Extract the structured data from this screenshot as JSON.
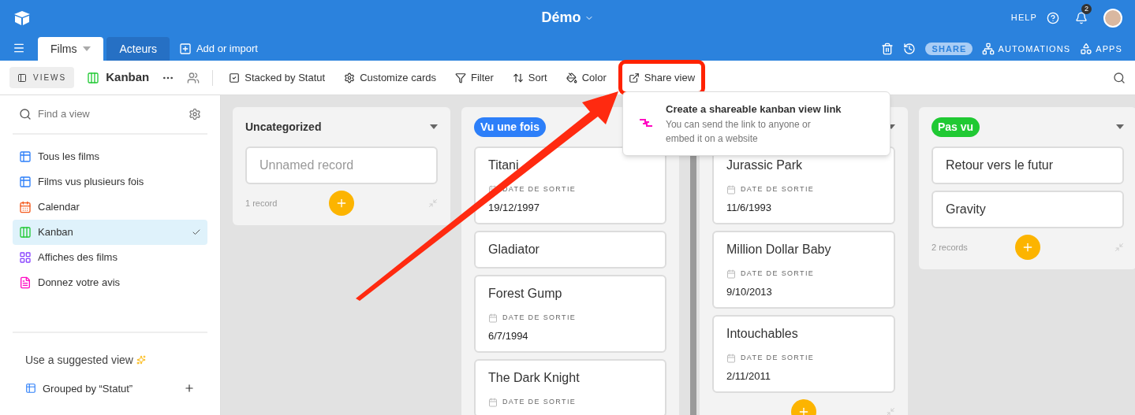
{
  "header": {
    "title": "Démo",
    "help": "HELP",
    "notifications": "2"
  },
  "tabs": [
    {
      "label": "Films",
      "selected": true
    },
    {
      "label": "Acteurs",
      "selected": false
    }
  ],
  "add_tab": "Add or import",
  "header_actions": {
    "share": "SHARE",
    "automations": "AUTOMATIONS",
    "apps": "APPS"
  },
  "toolbar": {
    "views": "VIEWS",
    "view_name": "Kanban",
    "items": [
      {
        "kind": "stacked",
        "label": "Stacked by Statut"
      },
      {
        "kind": "customize",
        "label": "Customize cards"
      },
      {
        "kind": "filter",
        "label": "Filter"
      },
      {
        "kind": "sort",
        "label": "Sort"
      },
      {
        "kind": "color",
        "label": "Color"
      },
      {
        "kind": "share",
        "label": "Share view",
        "highlighted": true
      }
    ]
  },
  "share_popup": {
    "title": "Create a shareable kanban view link",
    "description": "You can send the link to anyone or embed it on a website"
  },
  "sidebar": {
    "search": {
      "placeholder": "Find a view"
    },
    "items": [
      {
        "kind": "grid",
        "label": "Tous les films",
        "selected": false
      },
      {
        "kind": "grid",
        "label": "Films vus plusieurs fois",
        "selected": false
      },
      {
        "kind": "calendar",
        "label": "Calendar",
        "selected": false
      },
      {
        "kind": "kanban",
        "label": "Kanban",
        "selected": true
      },
      {
        "kind": "gallery",
        "label": "Affiches des films",
        "selected": false
      },
      {
        "kind": "form",
        "label": "Donnez votre avis",
        "selected": false
      }
    ],
    "suggested": {
      "title": "Use a suggested view",
      "items": [
        {
          "label": "Grouped by “Statut”"
        }
      ]
    }
  },
  "columns": [
    {
      "kind": "plain",
      "title": "Uncategorized",
      "cards": [
        {
          "title": "Unnamed record",
          "empty": true
        }
      ],
      "footer": "1 record"
    },
    {
      "kind": "badge",
      "title": "Vu une fois",
      "color": "#2d7ff9",
      "cards": [
        {
          "title": "Titani",
          "field": "DATE DE SORTIE",
          "value": "19/12/1997"
        },
        {
          "title": "Gladiator"
        },
        {
          "title": "Forest Gump",
          "field": "DATE DE SORTIE",
          "value": "6/7/1994"
        },
        {
          "title": "The Dark Knight",
          "field": "DATE DE SORTIE"
        }
      ]
    },
    {
      "kind": "hidden",
      "cards": [
        {
          "title": "Jurassic Park",
          "field": "DATE DE SORTIE",
          "value": "11/6/1993"
        },
        {
          "title": "Million Dollar Baby",
          "field": "DATE DE SORTIE",
          "value": "9/10/2013"
        },
        {
          "title": "Intouchables",
          "field": "DATE DE SORTIE",
          "value": "2/11/2011"
        }
      ],
      "add_button": true
    },
    {
      "kind": "badge",
      "title": "Pas vu",
      "color": "#20c933",
      "cards": [
        {
          "title": "Retour vers le futur"
        },
        {
          "title": "Gravity"
        }
      ],
      "footer": "2 records"
    }
  ]
}
